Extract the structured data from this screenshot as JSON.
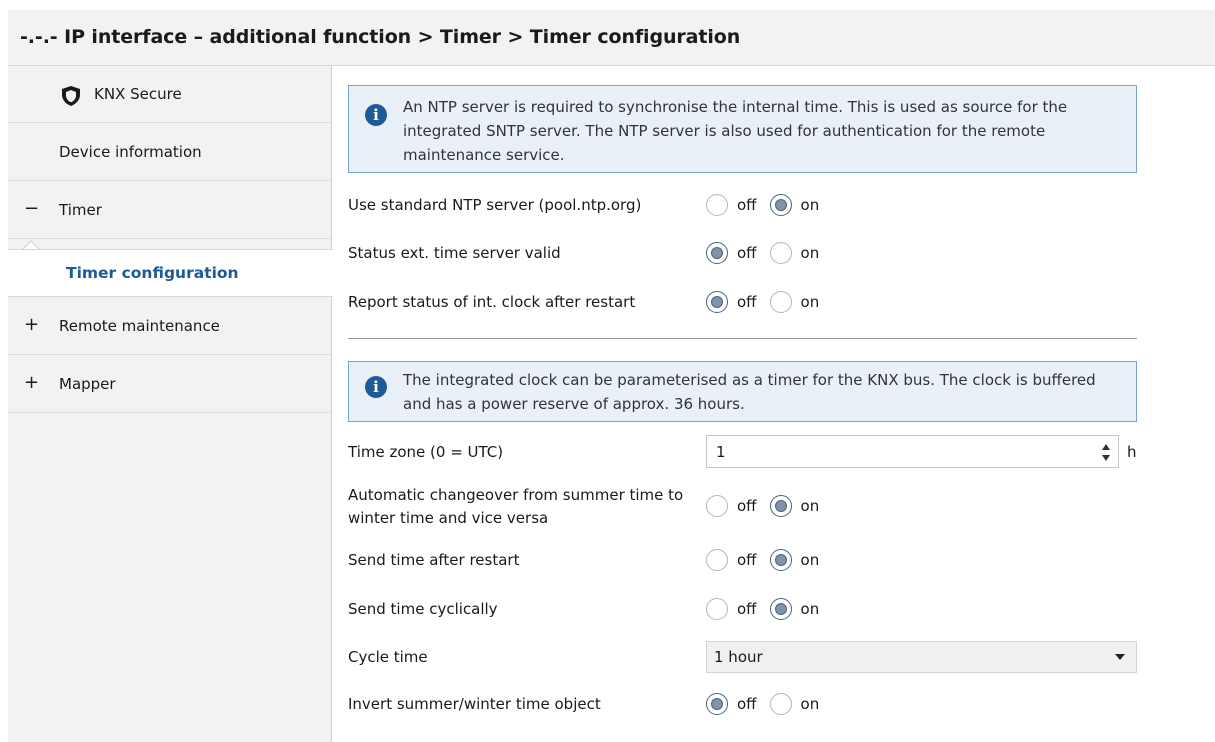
{
  "header": {
    "title": "-.-.- IP interface – additional function > Timer > Timer configuration"
  },
  "sidebar": {
    "items": [
      {
        "label": "KNX Secure",
        "icon": "shield-icon"
      },
      {
        "label": "Device information"
      },
      {
        "label": "Timer",
        "sign": "−"
      },
      {
        "label": "Timer configuration",
        "selected": true
      },
      {
        "label": "Remote maintenance",
        "sign": "+"
      },
      {
        "label": "Mapper",
        "sign": "+"
      }
    ]
  },
  "info1": {
    "text": "An NTP server is required to synchronise the internal time. This is used as source for the integrated SNTP server. The NTP server is also used for authentication for the remote maintenance service."
  },
  "info2": {
    "text": "The integrated clock can be parameterised as a timer for the KNX bus. The clock is buffered and has a power reserve of approx. 36 hours."
  },
  "radio_off": "off",
  "radio_on": "on",
  "params": {
    "ntp_server": {
      "label": "Use standard NTP server (pool.ntp.org)",
      "value": "on"
    },
    "status_ext": {
      "label": "Status ext. time server valid",
      "value": "off"
    },
    "report_status": {
      "label": "Report status of int. clock after restart",
      "value": "off"
    },
    "time_zone": {
      "label": "Time zone (0 = UTC)",
      "value": "1",
      "unit": "h"
    },
    "auto_changeover": {
      "label_line1": "Automatic changeover from summer time to",
      "label_line2": "winter time and vice versa",
      "value": "on"
    },
    "send_after_restart": {
      "label": "Send time after restart",
      "value": "on"
    },
    "send_cyclically": {
      "label": "Send time cyclically",
      "value": "on"
    },
    "cycle_time": {
      "label": "Cycle time",
      "value": "1 hour"
    },
    "invert_object": {
      "label": "Invert summer/winter time object",
      "value": "off"
    }
  },
  "colors": {
    "accent": "#1e5a96",
    "info_bg": "#e9f0f8",
    "info_border": "#7aa2cc"
  }
}
